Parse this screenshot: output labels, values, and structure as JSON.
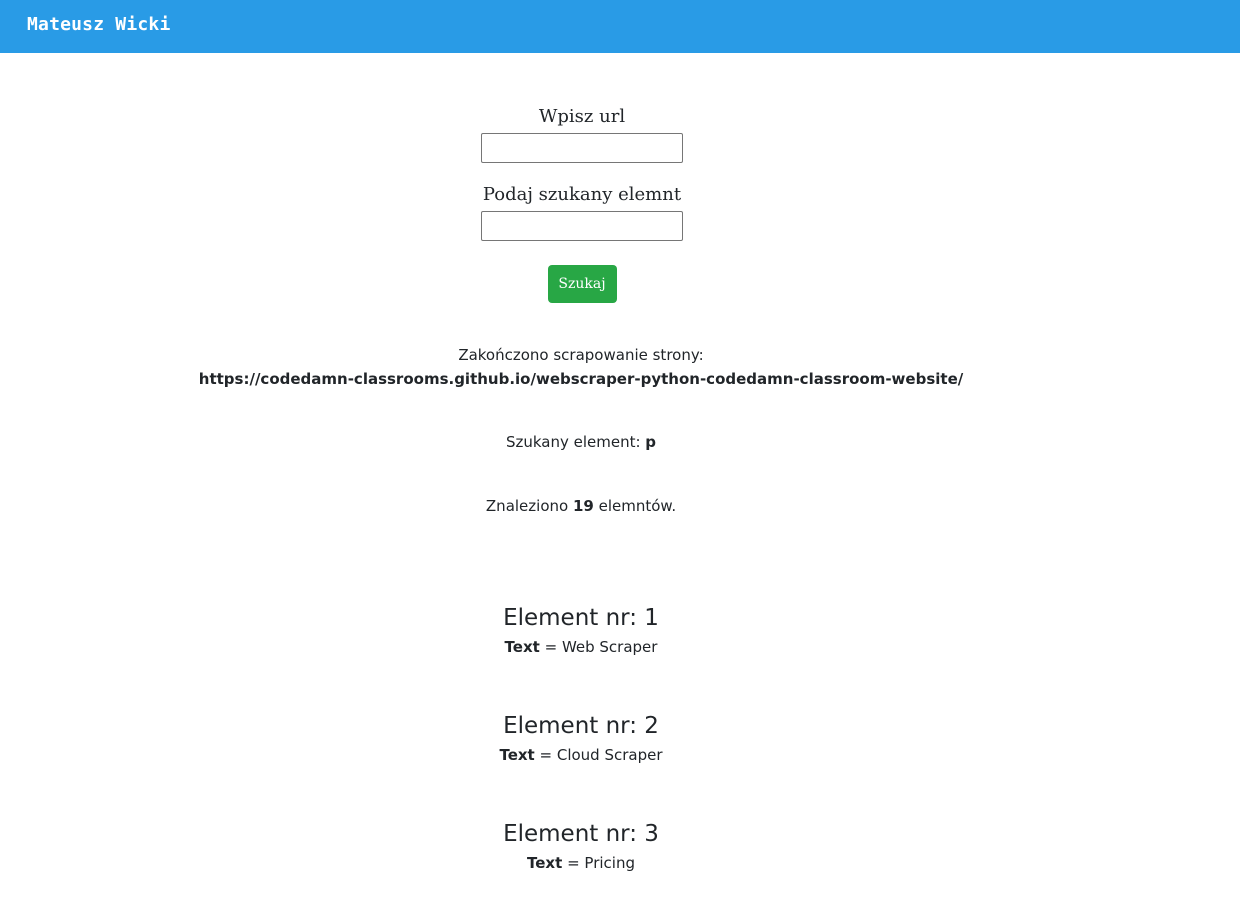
{
  "navbar": {
    "brand": "Mateusz Wicki"
  },
  "form": {
    "url_label": "Wpisz url",
    "url_value": "",
    "element_label": "Podaj szukany elemnt",
    "element_value": "",
    "submit_label": "Szukaj"
  },
  "results": {
    "status_prefix": "Zakończono scrapowanie strony:",
    "status_url": "https://codedamn-classrooms.github.io/webscraper-python-codedamn-classroom-website/",
    "search_prefix": "Szukany element:",
    "search_value": "p",
    "found_prefix": "Znaleziono",
    "found_count": "19",
    "found_suffix": "elemntów.",
    "elements": [
      {
        "title": "Element nr: 1",
        "key": "Text",
        "sep": "=",
        "value": "Web Scraper"
      },
      {
        "title": "Element nr: 2",
        "key": "Text",
        "sep": "=",
        "value": "Cloud Scraper"
      },
      {
        "title": "Element nr: 3",
        "key": "Text",
        "sep": "=",
        "value": "Pricing"
      }
    ]
  },
  "colors": {
    "navbar": "#299be6",
    "button": "#28a745"
  }
}
